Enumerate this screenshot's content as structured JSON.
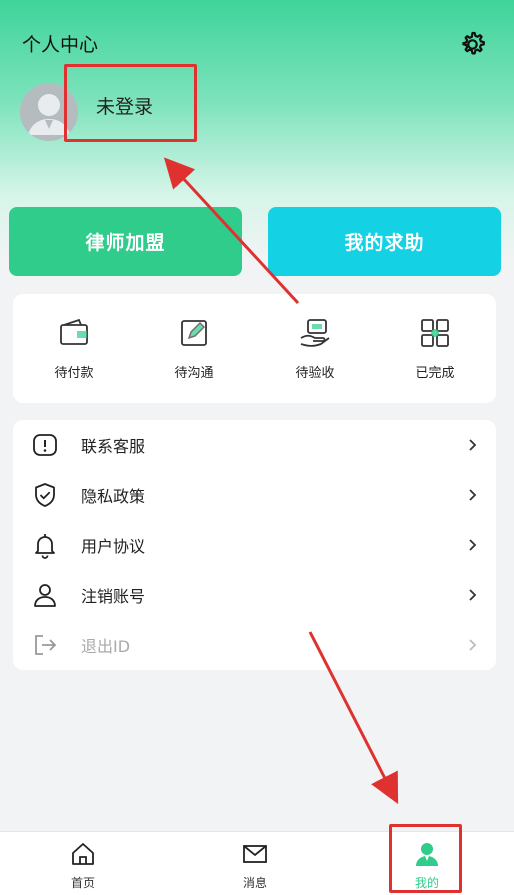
{
  "header": {
    "title": "个人中心",
    "login_status": "未登录"
  },
  "actions": {
    "lawyer_join": "律师加盟",
    "my_help": "我的求助"
  },
  "orders": [
    {
      "label": "待付款",
      "icon": "wallet-icon"
    },
    {
      "label": "待沟通",
      "icon": "edit-icon"
    },
    {
      "label": "待验收",
      "icon": "hand-card-icon"
    },
    {
      "label": "已完成",
      "icon": "grid-check-icon"
    }
  ],
  "menu": [
    {
      "label": "联系客服",
      "icon": "alert-icon"
    },
    {
      "label": "隐私政策",
      "icon": "shield-icon"
    },
    {
      "label": "用户协议",
      "icon": "bell-icon"
    },
    {
      "label": "注销账号",
      "icon": "user-icon"
    },
    {
      "label": "退出ID",
      "icon": "logout-icon"
    }
  ],
  "tabbar": [
    {
      "label": "首页",
      "icon": "home-icon"
    },
    {
      "label": "消息",
      "icon": "mail-icon"
    },
    {
      "label": "我的",
      "icon": "profile-icon"
    }
  ],
  "colors": {
    "accent": "#2fcc8b",
    "help": "#14d1e3",
    "annotation": "#e03131"
  }
}
